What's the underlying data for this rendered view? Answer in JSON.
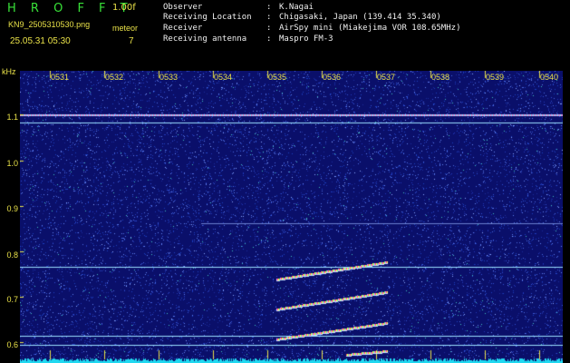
{
  "header": {
    "app_title": "H R O F F T",
    "version": "1.00f",
    "filename": "KN9_2505310530.png",
    "datetime": "25.05.31 05:30",
    "meteor_label": "meteor",
    "meteor_count": "7",
    "info": [
      {
        "key": "Observer",
        "value": "K.Nagai"
      },
      {
        "key": "Receiving Location",
        "value": "Chigasaki, Japan (139.414 35.340)"
      },
      {
        "key": "Receiver",
        "value": "AirSpy mini (Miakejima VOR 108.65MHz)"
      },
      {
        "key": "Receiving antenna",
        "value": "Maspro FM-3"
      }
    ]
  },
  "spectrogram": {
    "y_unit": "kHz",
    "y_ticks": [
      "1.1",
      "1.0",
      "0.9",
      "0.8",
      "0.7",
      "0.6"
    ],
    "x_ticks": [
      "0531",
      "0532",
      "0533",
      "0534",
      "0535",
      "0536",
      "0537",
      "0538",
      "0539",
      "0540"
    ],
    "colors": {
      "background": "#0a0f6a",
      "label": "#e8e048",
      "carrier": "#d0a0ff",
      "line": "#9be0ff"
    }
  }
}
